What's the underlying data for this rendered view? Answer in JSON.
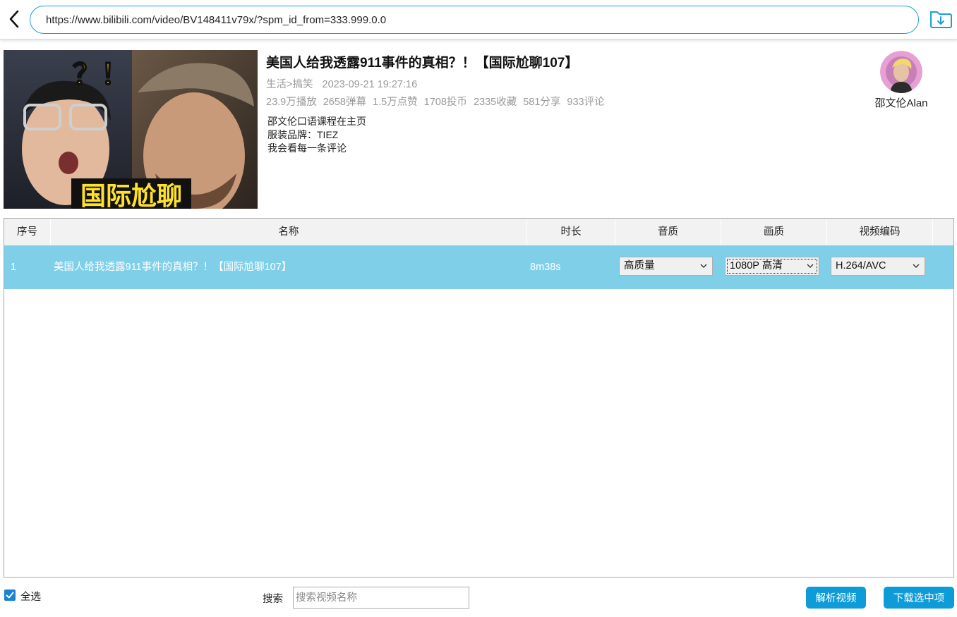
{
  "url_bar": {
    "value": "https://www.bilibili.com/video/BV148411v79x/?spm_id_from=333.999.0.0"
  },
  "video": {
    "title": "美国人给我透露911事件的真相？！【国际尬聊107】",
    "category": "生活>搞笑",
    "publish_time": "2023-09-21 19:27:16",
    "stats": [
      "23.9万播放",
      "2658弹幕",
      "1.5万点赞",
      "1708投币",
      "2335收藏",
      "581分享",
      "933评论"
    ],
    "description": [
      "邵文伦口语课程在主页",
      "服装品牌：TIEZ",
      "我会看每一条评论"
    ],
    "thumbnail_text": {
      "marks": "？！",
      "caption": "国际尬聊"
    }
  },
  "uploader": {
    "name": "邵文伦Alan"
  },
  "table": {
    "headers": {
      "index": "序号",
      "name": "名称",
      "duration": "时长",
      "audio": "音质",
      "video": "画质",
      "codec": "视频编码"
    },
    "rows": [
      {
        "index": "1",
        "name": "美国人给我透露911事件的真相？！【国际尬聊107】",
        "duration": "8m38s",
        "audio_quality": "高质量",
        "video_quality": "1080P 高清",
        "codec": "H.264/AVC"
      }
    ]
  },
  "footer": {
    "select_all_label": "全选",
    "select_all_checked": true,
    "search_label": "搜索",
    "search_placeholder": "搜索视频名称",
    "parse_button": "解析视频",
    "download_button": "下载选中项"
  },
  "colors": {
    "accent": "#0d9cd8",
    "selected_row": "#7fcfe9",
    "url_border": "#1d9fd6"
  }
}
